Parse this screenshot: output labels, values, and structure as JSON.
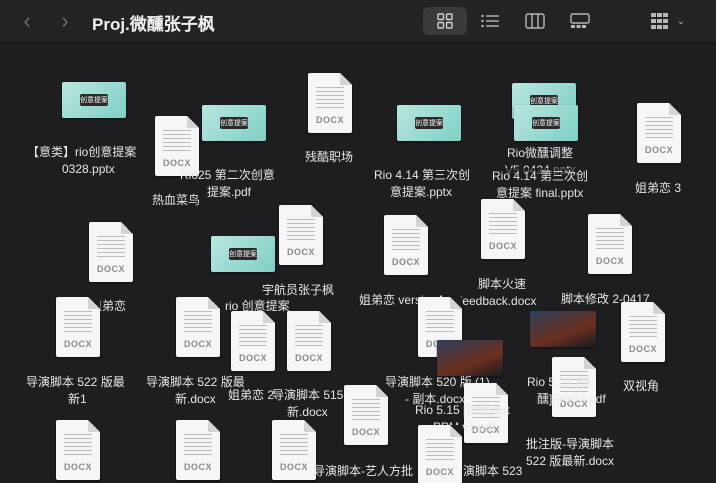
{
  "window": {
    "title": "Proj.微醺张子枫"
  },
  "toolbar": {
    "back_icon": "chevron-left-icon",
    "forward_icon": "chevron-right-icon",
    "view_icons": [
      "grid-view-icon",
      "list-view-icon",
      "column-view-icon",
      "gallery-view-icon",
      "group-by-icon"
    ]
  },
  "files": {
    "f1": "【意类】rio创意提案",
    "f1b": "0328.pptx",
    "f2": "热血菜鸟",
    "f3a": "Rio25 第二次创意",
    "f3b": "提案.pdf",
    "f4": "残酷职场",
    "f5a": "Rio 4.14 第三次创",
    "f5b": "意提案.pptx",
    "f6a": "Rio微醺调整",
    "f6b": "V5 0424.pptx",
    "f6c": "Rio 4.14 第三次创",
    "f6d": "意提案 final.pptx",
    "f7": "姐弟恋 3",
    "f8": "姐弟恋",
    "f9a": "宇航员张子枫",
    "f9b": "】rio 创意提案",
    "f10": "姐弟恋 versionA",
    "f11a": "脚本火速",
    "f11b": "feedback.docx",
    "f12": "脚本修改 2-0417",
    "f13a": "导演脚本 522 版最",
    "f13b": "新1",
    "f14a": "导演脚本 522 版最",
    "f14b": "新.docx",
    "f15": "姐弟恋 2",
    "f16a": "导演脚本 515",
    "f16b": "新.docx",
    "f17a": "导演脚本 520 版 (1)",
    "f17b": "- 副本.docx",
    "f18a": "Rio 5.15 [微醺]1st",
    "f18b": "PPM v1.pdf",
    "f19a": "Rio 5.21 [微",
    "f19b": "醺]FPPM.pdf",
    "f20": "双视角",
    "f21a": "批注版-导演脚本",
    "f21b": "522 版最新.docx",
    "f22": "导演脚本-艺人方批",
    "f23": "演脚本 523",
    "docx_tag": "DOCX",
    "thumb_text": "创意提案"
  }
}
